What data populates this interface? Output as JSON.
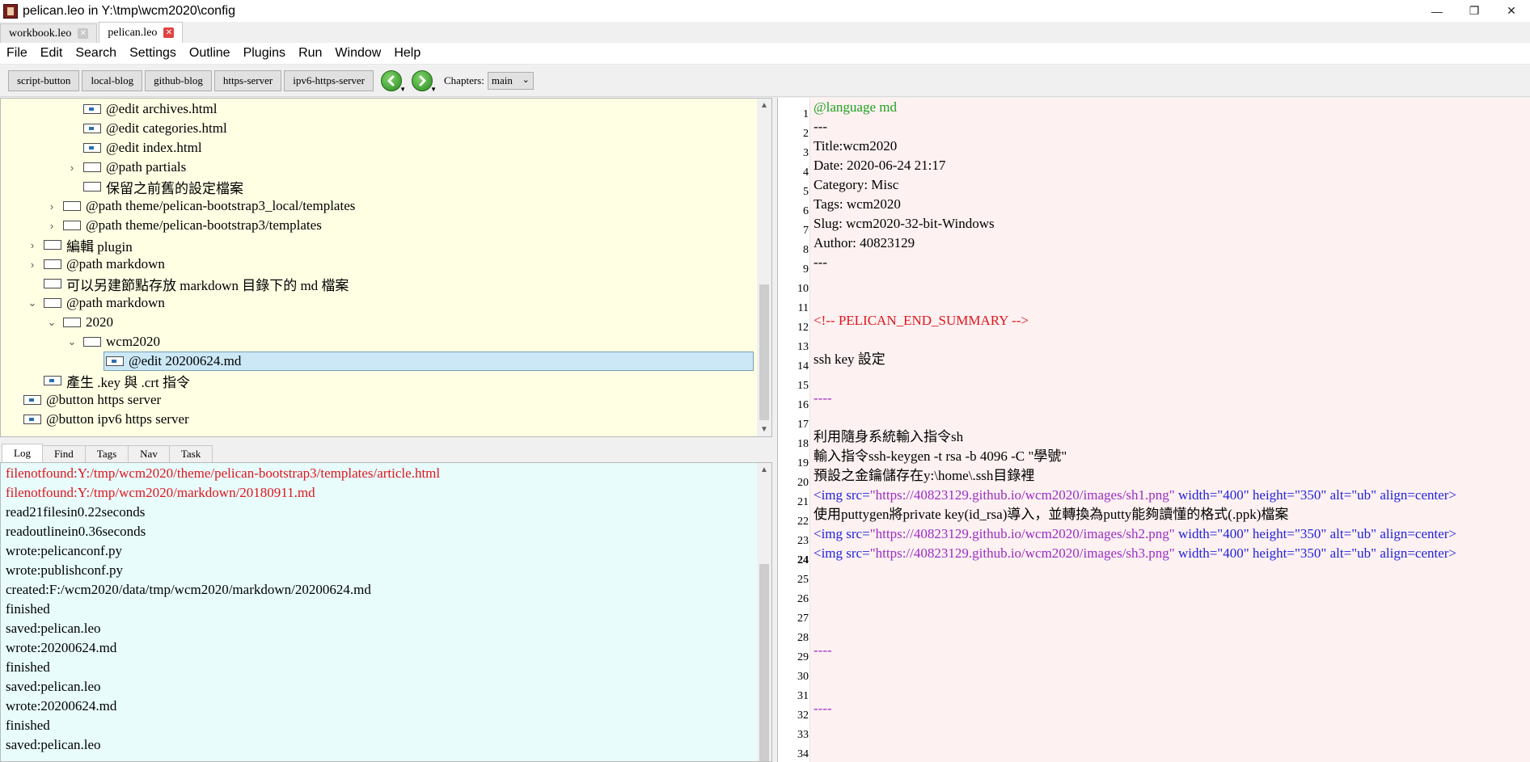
{
  "window": {
    "title": "pelican.leo in Y:\\tmp\\wcm2020\\config",
    "controls": {
      "minimize": "—",
      "maximize": "❐",
      "close": "✕"
    }
  },
  "tabs": [
    {
      "label": "workbook.leo"
    },
    {
      "label": "pelican.leo"
    }
  ],
  "menu": [
    "File",
    "Edit",
    "Search",
    "Settings",
    "Outline",
    "Plugins",
    "Run",
    "Window",
    "Help"
  ],
  "toolbar": {
    "buttons": [
      "script-button",
      "local-blog",
      "github-blog",
      "https-server",
      "ipv6-https-server"
    ],
    "chapters_label": "Chapters:",
    "chapters_value": "main"
  },
  "outline": {
    "rows": [
      {
        "text": "@edit archives.html"
      },
      {
        "text": "@edit categories.html"
      },
      {
        "text": "@edit index.html"
      },
      {
        "text": "@path partials"
      },
      {
        "text": "保留之前舊的設定檔案"
      },
      {
        "text": "@path theme/pelican-bootstrap3_local/templates"
      },
      {
        "text": "@path theme/pelican-bootstrap3/templates"
      },
      {
        "text": "編輯 plugin"
      },
      {
        "text": "@path markdown"
      },
      {
        "text": "可以另建節點存放 markdown 目錄下的 md 檔案"
      },
      {
        "text": "@path markdown"
      },
      {
        "text": "2020"
      },
      {
        "text": "wcm2020"
      },
      {
        "text": "@edit 20200624.md"
      },
      {
        "text": "產生 .key 與 .crt 指令"
      },
      {
        "text": "@button https server"
      },
      {
        "text": "@button ipv6 https server"
      }
    ]
  },
  "log_tabs": [
    "Log",
    "Find",
    "Tags",
    "Nav",
    "Task"
  ],
  "log": {
    "lines": [
      "filenotfound:Y:/tmp/wcm2020/theme/pelican-bootstrap3/templates/article.html",
      "filenotfound:Y:/tmp/wcm2020/markdown/20180911.md",
      "read21filesin0.22seconds",
      "readoutlinein0.36seconds",
      "wrote:pelicanconf.py",
      "wrote:publishconf.py",
      "created:F:/wcm2020/data/tmp/wcm2020/markdown/20200624.md",
      "finished",
      "saved:pelican.leo",
      "wrote:20200624.md",
      "finished",
      "saved:pelican.leo",
      "wrote:20200624.md",
      "finished",
      "saved:pelican.leo"
    ]
  },
  "editor": {
    "line_numbers": [
      "1",
      "2",
      "3",
      "4",
      "5",
      "6",
      "7",
      "8",
      "9",
      "10",
      "11",
      "12",
      "13",
      "14",
      "15",
      "16",
      "17",
      "18",
      "19",
      "20",
      "21",
      "22",
      "23",
      "24",
      "25",
      "26",
      "27",
      "28",
      "29",
      "30",
      "31",
      "32",
      "33",
      "34"
    ],
    "current_line": "24",
    "lines": {
      "l1": "@language md",
      "l2": "---",
      "l3": "Title:wcm2020",
      "l4": "Date: 2020-06-24 21:17",
      "l5": "Category: Misc",
      "l6": "Tags: wcm2020",
      "l7": "Slug: wcm2020-32-bit-Windows",
      "l8": "Author: 40823129",
      "l9": "---",
      "l12": "<!-- PELICAN_END_SUMMARY -->",
      "l14": "ssh key  設定",
      "l16": "----",
      "l18": "利用隨身系統輸入指令sh",
      "l19": "輸入指令ssh-keygen -t rsa -b 4096 -C \"學號\"",
      "l20": "預設之金鑰儲存在y:\\home\\.ssh目錄裡",
      "l21": {
        "tag_open": "<img src=",
        "url": "\"https://40823129.github.io/wcm2020/images/sh1.png\"",
        "attrs": " width=\"400\" height=\"350\" alt=\"ub\" align=center>"
      },
      "l22": "使用puttygen將private key(id_rsa)導入，並轉換為putty能夠讀懂的格式(.ppk)檔案",
      "l23": {
        "tag_open": "<img src=",
        "url": "\"https://40823129.github.io/wcm2020/images/sh2.png\"",
        "attrs": " width=\"400\" height=\"350\" alt=\"ub\" align=center>"
      },
      "l24": {
        "tag_open": "<img src=",
        "url": "\"https://40823129.github.io/wcm2020/images/sh3.png\"",
        "attrs": " width=\"400\" height=\"350\" alt=\"ub\" align=center>"
      },
      "l29": "----",
      "l32": "----"
    }
  },
  "colors": {
    "outline_bg": "#ffffe4",
    "log_bg": "#e8fcfc",
    "editor_bg": "#fdf1f1",
    "error_red": "#e0151c",
    "directive_green": "#1fa21f",
    "tag_blue": "#2222dd",
    "url_purple": "#9c2cc6"
  }
}
